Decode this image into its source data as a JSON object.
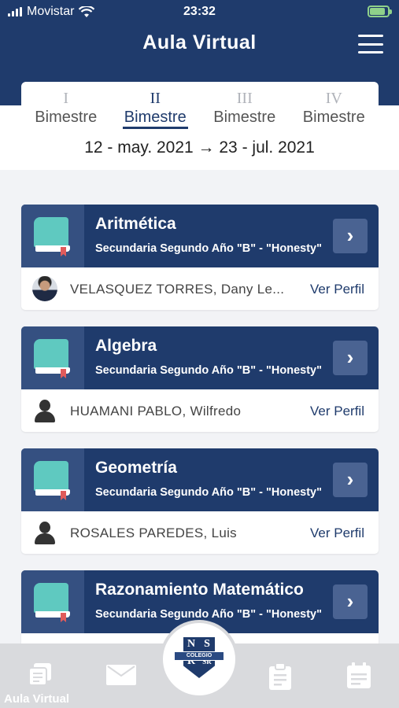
{
  "status": {
    "carrier": "Movistar",
    "time": "23:32"
  },
  "header": {
    "title": "Aula Virtual"
  },
  "terms": [
    {
      "num": "I",
      "label": "Bimestre"
    },
    {
      "num": "II",
      "label": "Bimestre"
    },
    {
      "num": "III",
      "label": "Bimestre"
    },
    {
      "num": "IV",
      "label": "Bimestre"
    }
  ],
  "active_term": "II",
  "dates": "12 - may. 2021 → 23 - jul. 2021",
  "courses": [
    {
      "name": "Aritmética",
      "section": "Secundaria Segundo Año \"B\" - \"Honesty\"",
      "teacher": "VELASQUEZ TORRES, Dany Le...",
      "link": "Ver Perfil"
    },
    {
      "name": "Algebra",
      "section": "Secundaria Segundo Año \"B\" - \"Honesty\"",
      "teacher": "HUAMANI PABLO, Wilfredo",
      "link": "Ver Perfil"
    },
    {
      "name": "Geometría",
      "section": "Secundaria Segundo Año \"B\" - \"Honesty\"",
      "teacher": "ROSALES PAREDES, Luis",
      "link": "Ver Perfil"
    },
    {
      "name": "Razonamiento Matemático",
      "section": "Secundaria Segundo Año \"B\" - \"Honesty\"",
      "teacher": "",
      "link": ""
    }
  ],
  "tabbar": {
    "active_label": "Aula Virtual",
    "logo": {
      "top_left": "N",
      "top_right": "S",
      "bottom_left": "R",
      "bottom_right": "SR",
      "banner": "COLEGIO"
    }
  },
  "colors": {
    "primary": "#1f3b6c",
    "icon_bg": "#355081",
    "tabbar_bg": "#d9dadd"
  }
}
